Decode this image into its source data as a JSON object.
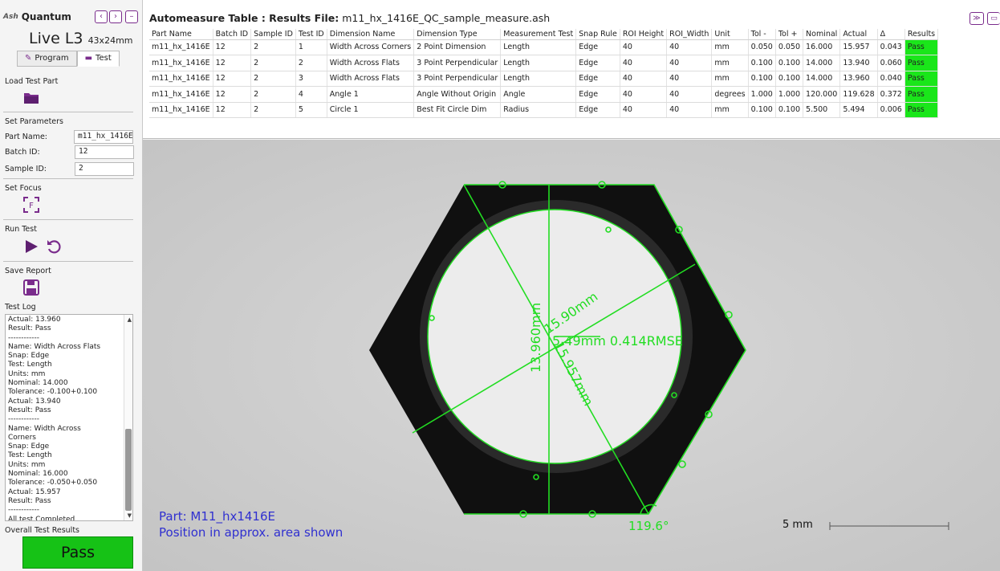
{
  "app": {
    "name": "Quantum",
    "logo_text": "Ash",
    "live_title": "Live L3",
    "live_size": "43x24mm"
  },
  "tabs": [
    {
      "label": "Program"
    },
    {
      "label": "Test"
    }
  ],
  "sidebar": {
    "load_label": "Load Test Part",
    "params_label": "Set Parameters",
    "part_name_label": "Part Name:",
    "part_name_value": "m11_hx_1416E",
    "batch_label": "Batch ID:",
    "batch_value": "12",
    "sample_label": "Sample ID:",
    "sample_value": "2",
    "focus_label": "Set Focus",
    "run_label": "Run Test",
    "save_label": "Save Report",
    "log_label": "Test Log",
    "log_text": "Actual: 13.960\nResult: Pass\n------------\nName: Width Across Flats\nSnap: Edge\nTest: Length\nUnits: mm\nNominal: 14.000\nTolerance: -0.100+0.100\nActual: 13.940\nResult: Pass\n------------\nName: Width Across\nCorners\nSnap: Edge\nTest: Length\nUnits: mm\nNominal: 16.000\nTolerance: -0.050+0.050\nActual: 15.957\nResult: Pass\n------------\nAll test Completed",
    "overall_label": "Overall Test Results",
    "overall_value": "Pass"
  },
  "table": {
    "title_prefix": "Automeasure Table : Results File:",
    "file": "m11_hx_1416E_QC_sample_measure.ash",
    "headers": [
      "Part Name",
      "Batch ID",
      "Sample ID",
      "Test ID",
      "Dimension Name",
      "Dimension Type",
      "Measurement Test",
      "Snap Rule",
      "ROI Height",
      "ROI_Width",
      "Unit",
      "Tol -",
      "Tol +",
      "Nominal",
      "Actual",
      "Δ",
      "Results"
    ],
    "rows": [
      [
        "m11_hx_1416E",
        "12",
        "2",
        "1",
        "Width Across Corners",
        "2 Point Dimension",
        "Length",
        "Edge",
        "40",
        "40",
        "mm",
        "0.050",
        "0.050",
        "16.000",
        "15.957",
        "0.043",
        "Pass"
      ],
      [
        "m11_hx_1416E",
        "12",
        "2",
        "2",
        "Width Across Flats",
        "3 Point Perpendicular",
        "Length",
        "Edge",
        "40",
        "40",
        "mm",
        "0.100",
        "0.100",
        "14.000",
        "13.940",
        "0.060",
        "Pass"
      ],
      [
        "m11_hx_1416E",
        "12",
        "2",
        "3",
        "Width Across Flats",
        "3 Point Perpendicular",
        "Length",
        "Edge",
        "40",
        "40",
        "mm",
        "0.100",
        "0.100",
        "14.000",
        "13.960",
        "0.040",
        "Pass"
      ],
      [
        "m11_hx_1416E",
        "12",
        "2",
        "4",
        "Angle 1",
        "Angle Without Origin",
        "Angle",
        "Edge",
        "40",
        "40",
        "degrees",
        "1.000",
        "1.000",
        "120.000",
        "119.628",
        "0.372",
        "Pass"
      ],
      [
        "m11_hx_1416E",
        "12",
        "2",
        "5",
        "Circle 1",
        "Best Fit Circle Dim",
        "Radius",
        "Edge",
        "40",
        "40",
        "mm",
        "0.100",
        "0.100",
        "5.500",
        "5.494",
        "0.006",
        "Pass"
      ]
    ]
  },
  "view": {
    "part_line": "Part: M11_hx1416E",
    "position_line": "Position in approx. area shown",
    "scale_label": "5 mm",
    "overlay_radius": "5.49mm 0.414RMSE",
    "overlay_v": "13.960mm",
    "overlay_diag1": "15.90mm",
    "overlay_diag2": "15.957mm",
    "overlay_angle": "119.6°"
  },
  "colors": {
    "accent": "#7a2c8c",
    "pass": "#1ae61a",
    "overlay": "#22dd22",
    "part_text": "#3030d0"
  }
}
